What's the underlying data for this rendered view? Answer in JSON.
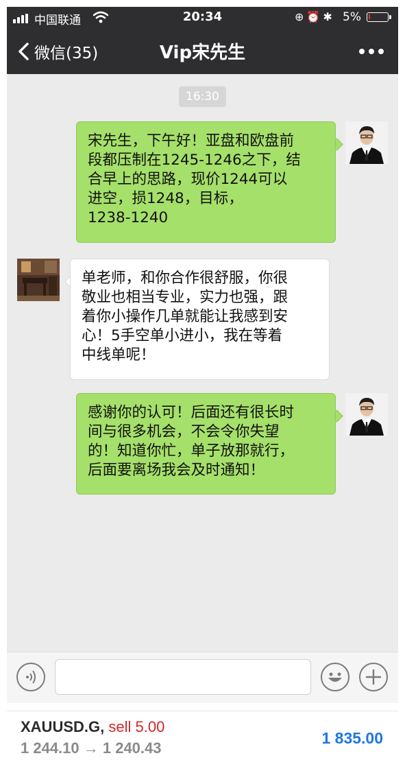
{
  "status_bar": {
    "carrier": "中国联通",
    "time": "20:34",
    "battery_percent": "5%",
    "battery_level": 0.05,
    "icons": [
      "signal-icon",
      "wifi-icon",
      "rotation-lock-icon",
      "alarm-icon",
      "bluetooth-icon",
      "battery-icon"
    ]
  },
  "nav": {
    "back_label": "微信(35)",
    "title": "Vip宋先生",
    "more_icon": "more-icon"
  },
  "chat": {
    "timestamp": "16:30",
    "messages": [
      {
        "side": "right",
        "text": "宋先生，下午好！亚盘和欧盘前\n段都压制在1245-1246之下，结\n合早上的思路，现价1244可以\n进空，损1248，目标，\n1238-1240"
      },
      {
        "side": "left",
        "text": "单老师，和你合作很舒服，你很\n敬业也相当专业，实力也强，跟\n着你小操作几单就能让我感到安\n心！5手空单小进小，我在等着\n中线单呢！"
      },
      {
        "side": "right",
        "text": "感谢你的认可！后面还有很长时\n间与很多机会，不会令你失望\n的！知道你忙，单子放那就行，\n后面要离场我会及时通知！"
      }
    ]
  },
  "input": {
    "value": "",
    "placeholder": ""
  },
  "trade": {
    "symbol": "XAUUSD.G,",
    "side": "sell 5.00",
    "prices": "1 244.10 → 1 240.43",
    "profit": "1 835.00"
  },
  "colors": {
    "bar_bg": "#2e2e30",
    "chat_bg": "#ebebeb",
    "bubble_green": "#a5e06a",
    "sell_red": "#d3262a",
    "profit_blue": "#1e76e3"
  }
}
